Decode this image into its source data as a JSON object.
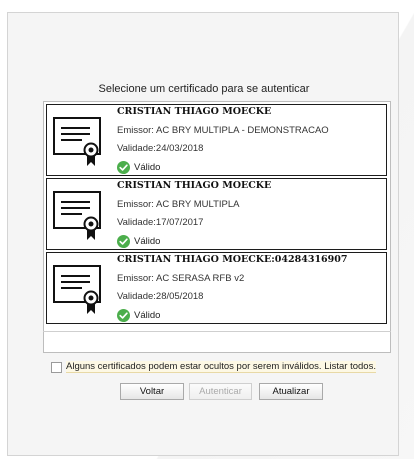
{
  "dialog": {
    "title": "Selecione um certificado para se autenticar"
  },
  "certificates": [
    {
      "name": "CRISTIAN THIAGO MOECKE",
      "issuer": "Emissor: AC BRY MULTIPLA - DEMONSTRACAO",
      "validity": "Validade:24/03/2018",
      "status": "Válido"
    },
    {
      "name": "CRISTIAN THIAGO MOECKE",
      "issuer": "Emissor: AC BRY MULTIPLA",
      "validity": "Validade:17/07/2017",
      "status": "Válido"
    },
    {
      "name": "CRISTIAN THIAGO MOECKE:04284316907",
      "issuer": "Emissor: AC SERASA RFB v2",
      "validity": "Validade:28/05/2018",
      "status": "Válido"
    }
  ],
  "show_all": {
    "label": "Alguns certificados podem estar ocultos por serem inválidos. Listar todos.",
    "checked": false
  },
  "buttons": {
    "back": "Voltar",
    "authenticate": "Autenticar",
    "refresh": "Atualizar"
  },
  "icons": {
    "certificate": "certificate-icon",
    "valid": "check-circle-icon"
  },
  "colors": {
    "valid_green": "#4cae4c",
    "panel_bg": "#f5f5f5"
  }
}
